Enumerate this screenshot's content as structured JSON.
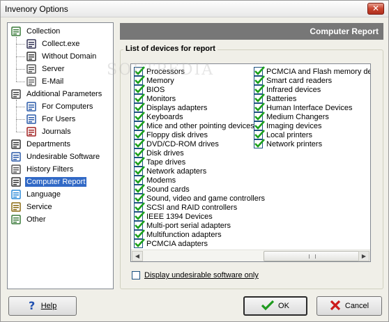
{
  "window": {
    "title": "Invenory Options",
    "close_glyph": "✕"
  },
  "tree": {
    "items": [
      {
        "label": "Collection",
        "icon": "checklist-icon",
        "level": 0
      },
      {
        "label": "Collect.exe",
        "icon": "window-icon",
        "level": 1
      },
      {
        "label": "Without Domain",
        "icon": "binoculars-icon",
        "level": 1
      },
      {
        "label": "Server",
        "icon": "server-icon",
        "level": 1
      },
      {
        "label": "E-Mail",
        "icon": "email-icon",
        "level": 1
      },
      {
        "label": "Additional Parameters",
        "icon": "parameters-icon",
        "level": 0
      },
      {
        "label": "For Computers",
        "icon": "computer-user-icon",
        "level": 1
      },
      {
        "label": "For Users",
        "icon": "user-icon",
        "level": 1
      },
      {
        "label": "Journals",
        "icon": "journals-icon",
        "level": 1
      },
      {
        "label": "Departments",
        "icon": "departments-icon",
        "level": 0
      },
      {
        "label": "Undesirable Software",
        "icon": "undesirable-software-icon",
        "level": 0
      },
      {
        "label": "History Filters",
        "icon": "history-filters-icon",
        "level": 0
      },
      {
        "label": "Computer Report",
        "icon": "report-icon",
        "level": 0,
        "selected": true
      },
      {
        "label": "Language",
        "icon": "globe-icon",
        "level": 0
      },
      {
        "label": "Service",
        "icon": "gears-icon",
        "level": 0
      },
      {
        "label": "Other",
        "icon": "other-icon",
        "level": 0
      }
    ]
  },
  "panel": {
    "title": "Computer Report",
    "group_title": "List of devices for report",
    "devices_col1": [
      "Processors",
      "Memory",
      "BIOS",
      "Monitors",
      "Displays adapters",
      "Keyboards",
      "Mice and other pointing devices",
      "Floppy disk drives",
      "DVD/CD-ROM drives",
      "Disk drives",
      "Tape drives",
      "Network adapters",
      "Modems",
      "Sound cards",
      "Sound, video and game controllers",
      "SCSI and RAID controllers",
      "IEEE 1394 Devices",
      "Multi-port serial adapters",
      "Multifunction adapters",
      "PCMCIA adapters"
    ],
    "devices_col2": [
      "PCMCIA and Flash memory dev",
      "Smart card readers",
      "Infrared devices",
      "Batteries",
      "Human Interface Devices",
      "Medium Changers",
      "Imaging devices",
      "Local printers",
      "Network printers"
    ],
    "display_undesirable_label": "Display undesirable software only",
    "watermark": "SOFTPEDIA"
  },
  "buttons": {
    "help": "Help",
    "ok": "OK",
    "cancel": "Cancel"
  },
  "scrollbar": {
    "left_arrow": "◀",
    "right_arrow": "▶"
  }
}
